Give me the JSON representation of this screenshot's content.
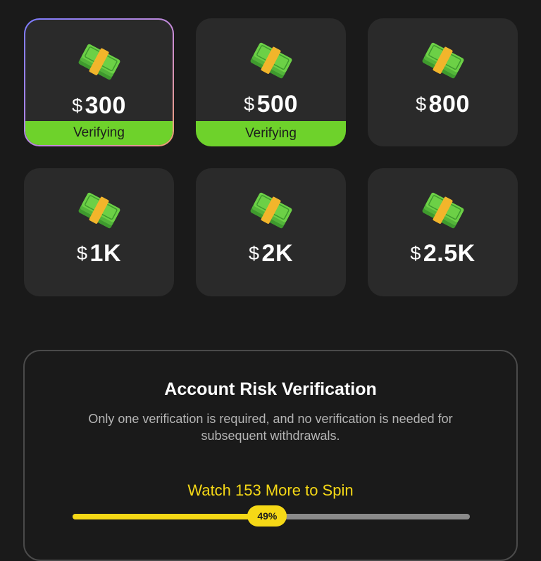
{
  "currency_symbol": "$",
  "colors": {
    "background": "#1a1a1a",
    "card": "#2a2a2a",
    "verify_green": "#6ed22b",
    "accent_yellow": "#f5d816",
    "track_gray": "#8a8a8a"
  },
  "icons": {
    "card_icon": "money-stack-icon"
  },
  "cards": [
    {
      "amount": "300",
      "status": "Verifying",
      "selected": true
    },
    {
      "amount": "500",
      "status": "Verifying",
      "selected": false
    },
    {
      "amount": "800",
      "status": "",
      "selected": false
    },
    {
      "amount": "1K",
      "status": "",
      "selected": false
    },
    {
      "amount": "2K",
      "status": "",
      "selected": false
    },
    {
      "amount": "2.5K",
      "status": "",
      "selected": false
    }
  ],
  "verification": {
    "title": "Account Risk Verification",
    "description": "Only one verification is required, and no verification is needed for subsequent withdrawals.",
    "spin_text": "Watch 153 More to Spin",
    "progress_percent": 49,
    "progress_label": "49%"
  }
}
